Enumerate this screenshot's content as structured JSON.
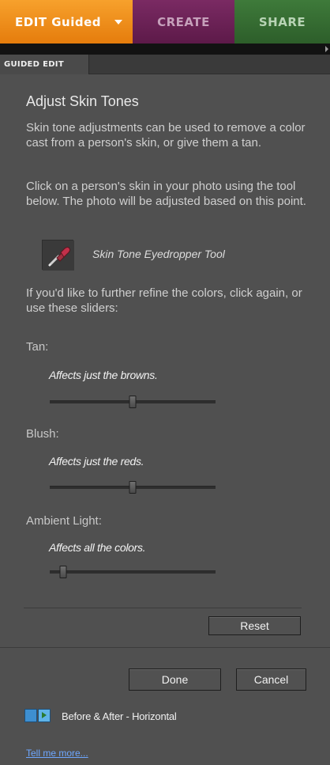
{
  "tabs": {
    "edit": "EDIT Guided",
    "create": "CREATE",
    "share": "SHARE"
  },
  "panel_tab": "GUIDED EDIT",
  "title": "Adjust Skin Tones",
  "paragraphs": [
    "Skin tone adjustments can be used to remove a color cast from a person's skin, or give them a tan.",
    "Click on a person's skin in your photo using the tool below. The photo will be adjusted based on this point.",
    "If you'd like to further refine the colors, click again, or use these sliders:"
  ],
  "tool": {
    "label": "Skin Tone Eyedropper Tool",
    "icon": "eyedropper-icon"
  },
  "sliders": [
    {
      "label": "Tan:",
      "desc": "Affects just the browns.",
      "value": 0.5
    },
    {
      "label": "Blush:",
      "desc": "Affects just the reds.",
      "value": 0.5
    },
    {
      "label": "Ambient Light:",
      "desc": "Affects all the colors.",
      "value": 0.08
    }
  ],
  "buttons": {
    "reset": "Reset",
    "done": "Done",
    "cancel": "Cancel"
  },
  "before_after": {
    "label": "Before & After - Horizontal",
    "icon": "before-after-horizontal-icon"
  },
  "tell_me_more": "Tell me more...",
  "colors": {
    "edit_tab": "#f39a24",
    "create_tab": "#6b2157",
    "share_tab": "#35693a",
    "panel_bg": "#505050",
    "link": "#6ea7ff"
  }
}
